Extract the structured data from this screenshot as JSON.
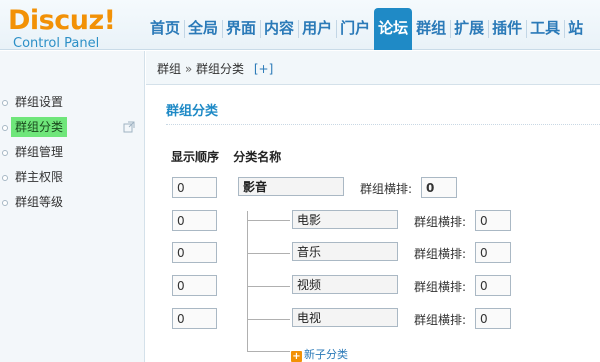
{
  "brand": {
    "name": "Discuz!",
    "subtitle": "Control Panel"
  },
  "nav": [
    {
      "label": "首页"
    },
    {
      "label": "全局"
    },
    {
      "label": "界面"
    },
    {
      "label": "内容"
    },
    {
      "label": "用户"
    },
    {
      "label": "门户"
    },
    {
      "label": "论坛",
      "active": true
    },
    {
      "label": "群组"
    },
    {
      "label": "扩展"
    },
    {
      "label": "插件"
    },
    {
      "label": "工具"
    },
    {
      "label": "站"
    }
  ],
  "sidebar": {
    "items": [
      {
        "label": "群组设置"
      },
      {
        "label": "群组分类",
        "active": true
      },
      {
        "label": "群组管理"
      },
      {
        "label": "群主权限"
      },
      {
        "label": "群组等级"
      }
    ]
  },
  "breadcrumb": {
    "root": "群组",
    "sep": "»",
    "current": "群组分类",
    "add": "[+]"
  },
  "section": {
    "title": "群组分类"
  },
  "table": {
    "col_order": "显示顺序",
    "col_name": "分类名称",
    "row_label": "群组横排:",
    "parent": {
      "order": "0",
      "name": "影音",
      "per_row": "0"
    },
    "children": [
      {
        "order": "0",
        "name": "电影",
        "per_row": "0"
      },
      {
        "order": "0",
        "name": "音乐",
        "per_row": "0"
      },
      {
        "order": "0",
        "name": "视频",
        "per_row": "0"
      },
      {
        "order": "0",
        "name": "电视",
        "per_row": "0"
      }
    ],
    "add_child": "新子分类"
  },
  "colors": {
    "accent": "#1f8ac6",
    "brand_orange": "#f29106",
    "active_side": "#6fe67a"
  }
}
